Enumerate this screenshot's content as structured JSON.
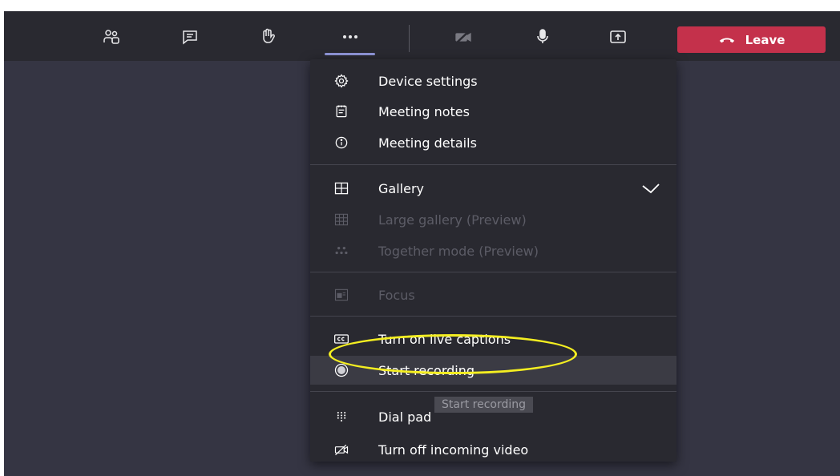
{
  "toolbar": {
    "buttons": [
      {
        "name": "participants",
        "icon": "people-icon"
      },
      {
        "name": "chat",
        "icon": "chat-icon"
      },
      {
        "name": "raise-hand",
        "icon": "hand-icon"
      },
      {
        "name": "more-actions",
        "icon": "more-icon"
      },
      {
        "name": "camera",
        "icon": "camera-off-icon"
      },
      {
        "name": "microphone",
        "icon": "microphone-icon"
      },
      {
        "name": "share",
        "icon": "share-tray-icon"
      }
    ],
    "leave_label": "Leave",
    "leave_color": "#c4314b",
    "accent_color": "#8f95d8"
  },
  "menu": {
    "items": [
      {
        "label": "Device settings",
        "icon": "gear-icon",
        "enabled": true
      },
      {
        "label": "Meeting notes",
        "icon": "notes-icon",
        "enabled": true
      },
      {
        "label": "Meeting details",
        "icon": "info-icon",
        "enabled": true
      },
      {
        "label": "Gallery",
        "icon": "gallery-icon",
        "enabled": true,
        "checked": true
      },
      {
        "label": "Large gallery (Preview)",
        "icon": "large-gallery-icon",
        "enabled": false
      },
      {
        "label": "Together mode (Preview)",
        "icon": "together-mode-icon",
        "enabled": false
      },
      {
        "label": "Focus",
        "icon": "focus-icon",
        "enabled": false
      },
      {
        "label": "Turn on live captions",
        "icon": "captions-icon",
        "enabled": true
      },
      {
        "label": "Start recording",
        "icon": "record-icon",
        "enabled": true,
        "highlighted": true
      },
      {
        "label": "Dial pad",
        "icon": "dialpad-icon",
        "enabled": true
      },
      {
        "label": "Turn off incoming video",
        "icon": "video-off-icon",
        "enabled": true
      }
    ]
  },
  "tooltip": {
    "text": "Start recording"
  },
  "annotation": {
    "color": "#f4ee21"
  }
}
